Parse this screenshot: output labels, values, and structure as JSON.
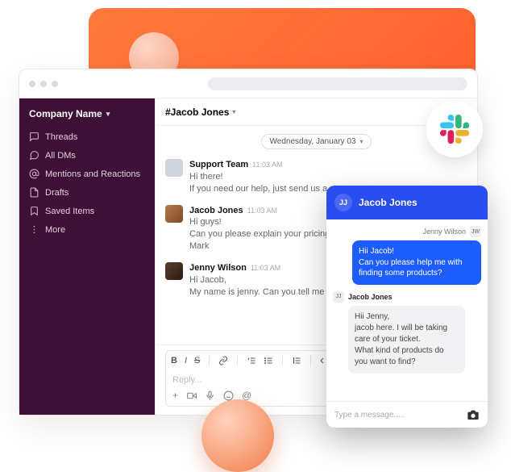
{
  "sidebar": {
    "workspace": "Company Name",
    "items": [
      {
        "icon": "threads",
        "label": "Threads"
      },
      {
        "icon": "dms",
        "label": "All DMs"
      },
      {
        "icon": "mentions",
        "label": "Mentions and Reactions"
      },
      {
        "icon": "drafts",
        "label": "Drafts"
      },
      {
        "icon": "saved",
        "label": "Saved Items"
      },
      {
        "icon": "more",
        "label": "More"
      }
    ]
  },
  "channel": {
    "name": "#Jacob Jones",
    "date_pill": "Wednesday, January 03"
  },
  "messages": [
    {
      "author": "Support Team",
      "time": "11:03 AM",
      "lines": [
        "Hi there!",
        "If you need our help, just send us a message to our support team."
      ]
    },
    {
      "author": "Jacob Jones",
      "time": "11:03 AM",
      "lines": [
        "Hi guys!",
        "Can you please explain your pricing plans?",
        "Mark"
      ]
    },
    {
      "author": "Jenny Wilson",
      "time": "11:03 AM",
      "lines": [
        "Hi Jacob,",
        "My name is jenny. Can you tell me what pricing plan do you"
      ]
    }
  ],
  "composer": {
    "placeholder": "Reply..."
  },
  "chat_widget": {
    "header_name": "Jacob Jones",
    "header_initials": "JJ",
    "sender_name": "Jenny Wilson",
    "sender_initials": "JW",
    "out_lines": [
      "Hii Jacob!",
      "Can you please help me with finding some products?"
    ],
    "recipient_name": "Jacob Jones",
    "recipient_initials": "JJ",
    "in_lines": [
      "Hii Jenny,",
      "jacob here. I will be taking care of your ticket.",
      "What kind of products do you want to find?"
    ],
    "input_placeholder": "Type a message....."
  }
}
